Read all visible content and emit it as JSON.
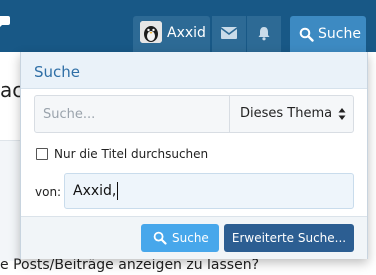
{
  "header": {
    "account_name": "Axxid",
    "search_tab_label": "Suche",
    "icons": {
      "left": "chat-bubbles-icon",
      "inbox": "envelope-icon",
      "alerts": "bell-icon",
      "search": "magnifier-icon"
    }
  },
  "background": {
    "partial_title": "ac",
    "bottom_line": "e Posts/Beiträge anzeigen zu lassen?"
  },
  "search_menu": {
    "title": "Suche",
    "query": {
      "value": "",
      "placeholder": "Suche..."
    },
    "scope_selected": "Dieses Thema",
    "titles_only_label": "Nur die Titel durchsuchen",
    "titles_only_checked": false,
    "from_label": "von:",
    "from_value": "Axxid,",
    "search_button_label": "Suche",
    "advanced_button_label": "Erweiterte Suche..."
  },
  "colors": {
    "header_bg": "#185886",
    "search_tab": "#3d8ac2",
    "primary_button": "#47a7eb",
    "secondary_button": "#2c5e92",
    "menu_title": "#2f6fa6"
  }
}
